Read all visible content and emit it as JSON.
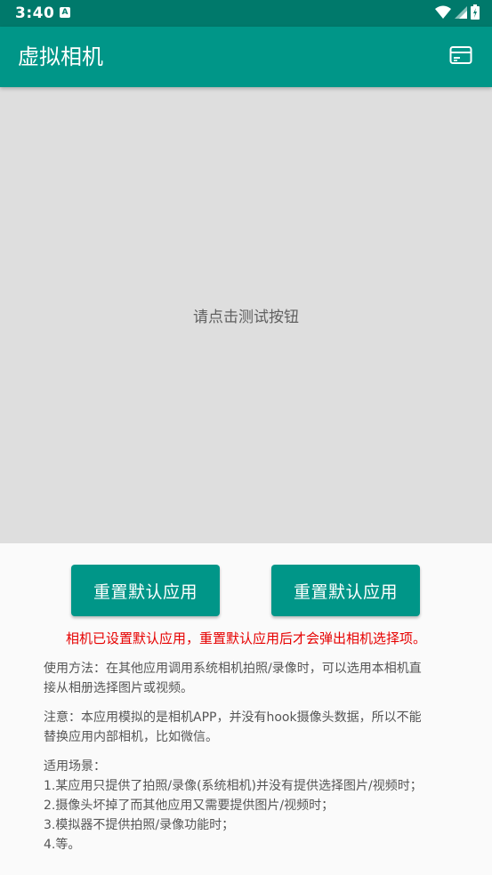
{
  "status_bar": {
    "time": "3:40",
    "notification_icon": "A"
  },
  "app_bar": {
    "title": "虚拟相机",
    "action_icon": "card-icon"
  },
  "preview": {
    "hint": "请点击测试按钮"
  },
  "buttons": {
    "left_label": "重置默认应用",
    "right_label": "重置默认应用"
  },
  "warning": "相机已设置默认应用，重置默认应用后才会弹出相机选择项。",
  "usage": {
    "line1": "使用方法：在其他应用调用系统相机拍照/录像时，可以选用本相机直",
    "line2": "接从相册选择图片或视频。"
  },
  "note": {
    "line1": "注意：本应用模拟的是相机APP，并没有hook摄像头数据，所以不能",
    "line2": "替换应用内部相机，比如微信。"
  },
  "scenarios": {
    "heading": "适用场景：",
    "items": [
      "1.某应用只提供了拍照/录像(系统相机)并没有提供选择图片/视频时；",
      "2.摄像头坏掉了而其他应用又需要提供图片/视频时；",
      "3.模拟器不提供拍照/录像功能时；",
      "4.等。"
    ]
  },
  "colors": {
    "status_bar": "#00796b",
    "app_bar": "#009688",
    "preview_bg": "#dedede",
    "warning": "#e60000"
  }
}
